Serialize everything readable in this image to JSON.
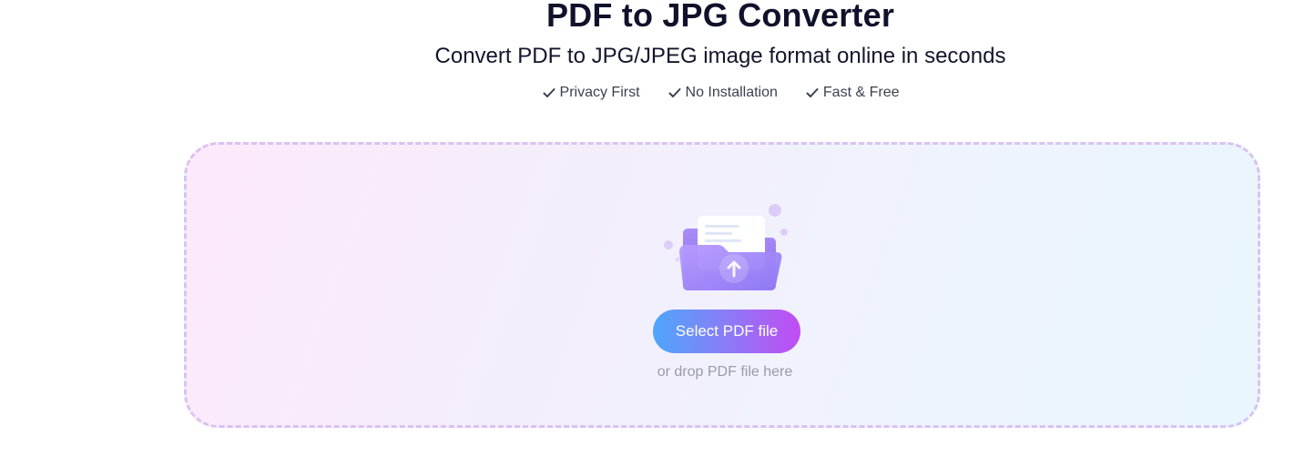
{
  "header": {
    "title": "PDF to JPG Converter",
    "subtitle": "Convert PDF to JPG/JPEG image format online in seconds",
    "features": [
      {
        "label": "Privacy First",
        "icon": "check-icon"
      },
      {
        "label": "No Installation",
        "icon": "check-icon"
      },
      {
        "label": "Fast & Free",
        "icon": "check-icon"
      }
    ]
  },
  "dropzone": {
    "illustration_icon": "folder-upload-icon",
    "select_label": "Select PDF file",
    "drop_hint": "or drop PDF file here"
  },
  "colors": {
    "title": "#10122b",
    "button_gradient_start": "#4da6fb",
    "button_gradient_end": "#c14cf3",
    "dropzone_border": "#d9c2f2"
  }
}
